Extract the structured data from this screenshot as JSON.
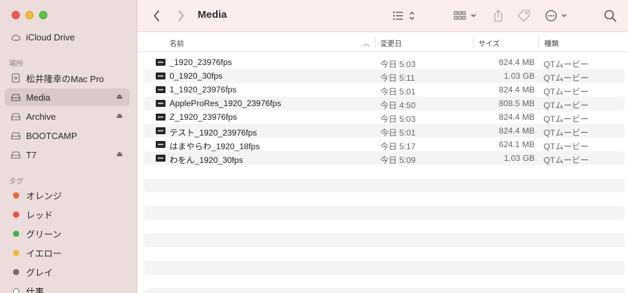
{
  "window": {
    "title": "Media"
  },
  "sidebar": {
    "items_top": [
      {
        "label": "iCloud Drive",
        "icon": "cloud-icon"
      }
    ],
    "locations_header": "場所",
    "locations": [
      {
        "label": "松井隆幸のMac Pro",
        "icon": "mac-pro-icon",
        "eject": false,
        "selected": false
      },
      {
        "label": "Media",
        "icon": "drive-icon",
        "eject": true,
        "selected": true
      },
      {
        "label": "Archive",
        "icon": "drive-icon",
        "eject": true,
        "selected": false
      },
      {
        "label": "BOOTCAMP",
        "icon": "drive-icon",
        "eject": false,
        "selected": false
      },
      {
        "label": "T7",
        "icon": "drive-icon",
        "eject": true,
        "selected": false
      }
    ],
    "tags_header": "タグ",
    "tags": [
      {
        "label": "オレンジ",
        "color": "#f0623a"
      },
      {
        "label": "レッド",
        "color": "#ee4b3e"
      },
      {
        "label": "グリーン",
        "color": "#3bb54a"
      },
      {
        "label": "イエロー",
        "color": "#f5b82e"
      },
      {
        "label": "グレイ",
        "color": "#6e6e6e"
      },
      {
        "label": "仕事",
        "color": "#ffffff"
      }
    ]
  },
  "toolbar": {
    "back_icon": "chevron-left-icon",
    "forward_icon": "chevron-right-icon",
    "view_icon": "list-view-icon",
    "group_icon": "grid-group-icon",
    "share_icon": "share-icon",
    "tag_icon": "tag-icon",
    "action_icon": "ellipsis-circle-icon",
    "search_icon": "search-icon"
  },
  "columns": {
    "name": "名前",
    "date": "変更日",
    "size": "サイズ",
    "kind": "種類"
  },
  "files": [
    {
      "name": "_1920_23976fps",
      "date": "今日 5:03",
      "size": "824.4 MB",
      "kind": "QTムービー"
    },
    {
      "name": "0_1920_30fps",
      "date": "今日 5:11",
      "size": "1.03 GB",
      "kind": "QTムービー"
    },
    {
      "name": "1_1920_23976fps",
      "date": "今日 5:01",
      "size": "824.4 MB",
      "kind": "QTムービー"
    },
    {
      "name": "AppleProRes_1920_23976fps",
      "date": "今日 4:50",
      "size": "808.5 MB",
      "kind": "QTムービー"
    },
    {
      "name": "Z_1920_23976fps",
      "date": "今日 5:03",
      "size": "824.4 MB",
      "kind": "QTムービー"
    },
    {
      "name": "テスト_1920_23976fps",
      "date": "今日 5:01",
      "size": "824.4 MB",
      "kind": "QTムービー"
    },
    {
      "name": "はまやらわ_1920_18fps",
      "date": "今日 5:17",
      "size": "624.1 MB",
      "kind": "QTムービー"
    },
    {
      "name": "わをん_1920_30fps",
      "date": "今日 5:09",
      "size": "1.03 GB",
      "kind": "QTムービー"
    }
  ]
}
